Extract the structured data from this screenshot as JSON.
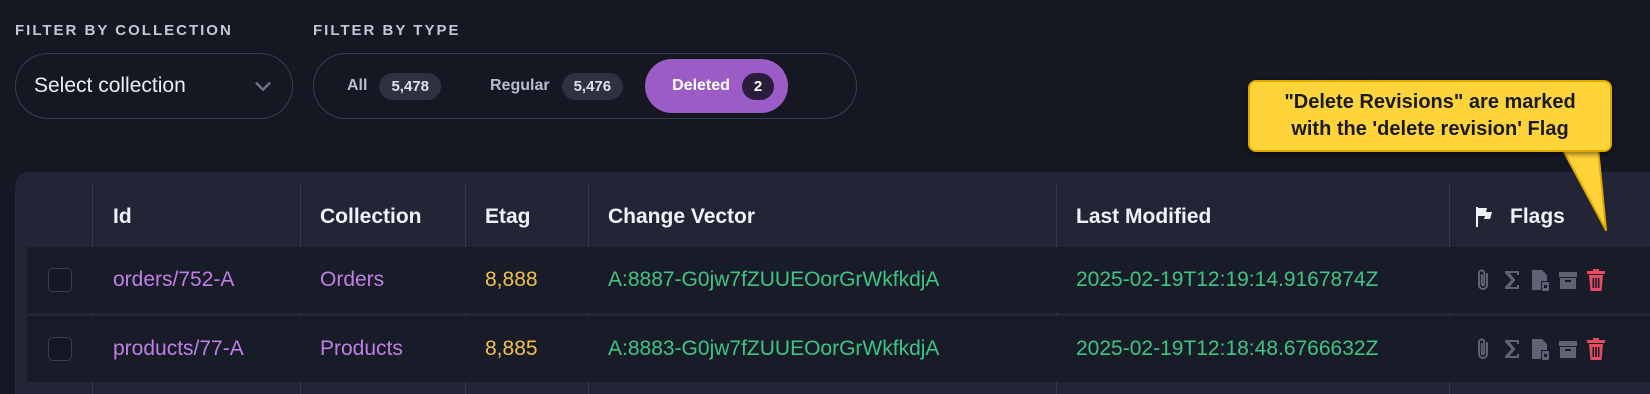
{
  "filters": {
    "collection_label": "FILTER BY COLLECTION",
    "collection_placeholder": "Select collection",
    "type_label": "FILTER BY TYPE",
    "types": [
      {
        "label": "All",
        "count": "5,478"
      },
      {
        "label": "Regular",
        "count": "5,476"
      },
      {
        "label": "Deleted",
        "count": "2"
      }
    ],
    "active_type": "Deleted"
  },
  "callout": {
    "line1": "\"Delete Revisions\" are marked",
    "line2": "with the 'delete revision' Flag"
  },
  "table": {
    "columns": [
      "Id",
      "Collection",
      "Etag",
      "Change Vector",
      "Last Modified",
      "Flags"
    ],
    "rows": [
      {
        "id": "orders/752-A",
        "collection": "Orders",
        "etag": "8,888",
        "change_vector": "A:8887-G0jw7fZUUEOorGrWkfkdjA",
        "last_modified": "2025-02-19T12:19:14.9167874Z"
      },
      {
        "id": "products/77-A",
        "collection": "Products",
        "etag": "8,885",
        "change_vector": "A:8883-G0jw7fZUUEOorGrWkfkdjA",
        "last_modified": "2025-02-19T12:18:48.6766632Z"
      }
    ],
    "flag_icons": [
      "attachment-icon",
      "sigma-icon",
      "document-icon",
      "archive-icon",
      "trash-icon"
    ]
  },
  "colors": {
    "accent": "#9b5cc6",
    "id_link": "#c17fe6",
    "etag": "#f2c04b",
    "change_vector": "#3dc582",
    "delete_flag": "#e54a5f",
    "callout": "#ffd43b"
  }
}
